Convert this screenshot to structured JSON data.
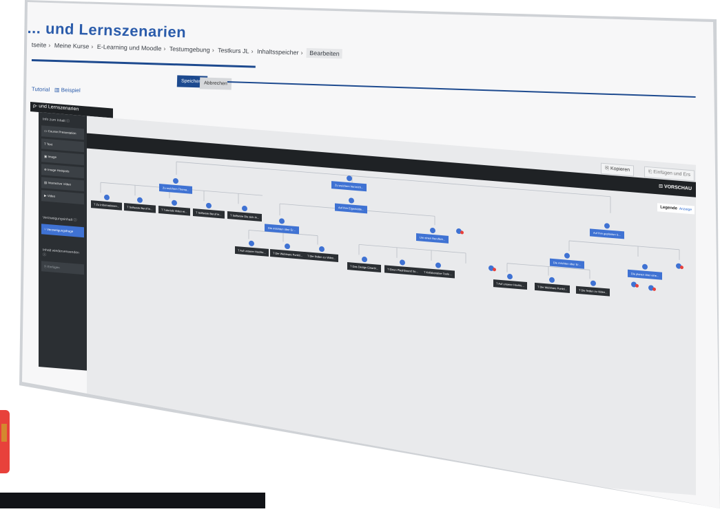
{
  "page": {
    "title": "... und Lernszenarien"
  },
  "breadcrumb": [
    "tseite",
    "Meine Kurse",
    "E-Learning und Moodle",
    "Testumgebung",
    "Testkurs JL",
    "Inhaltsspeicher",
    "Bearbeiten"
  ],
  "actions": {
    "save": "Speichern",
    "cancel": "Abbrechen"
  },
  "links": {
    "tutorial": "Tutorial",
    "example": "Beispiel"
  },
  "editor": {
    "header": "ρ- und Lernszenarien",
    "sidebar": {
      "section_content": "Info zum Inhalt ⓘ",
      "items": [
        "Course Presentation",
        "Text",
        "Image",
        "Image Hotspots",
        "Interactive Video",
        "Video"
      ],
      "section_branch": "Verzweigungsinhalt ⓘ",
      "branch_item": "Verzweigungsfrage",
      "section_reuse": "Inhalt wiederverwenden ⓘ",
      "reuse_item": "Einfügen"
    },
    "toolbar": {
      "copy": "Kopieren",
      "paste": "Einfügen und Ers",
      "preview": "VORSCHAU"
    },
    "legend": {
      "label": "Legende",
      "action": "Anzeige"
    }
  },
  "tree_nodes": [
    {
      "label": "Zu welchem Verzeich...",
      "kind": "question"
    },
    {
      "label": "Zu welchem Thema...",
      "kind": "question"
    },
    {
      "label": "Auf Ihre Eigenkätte...",
      "kind": "question"
    },
    {
      "label": "Auf Ihre geplanten S...",
      "kind": "question"
    },
    {
      "label": "Die möchten über Er...",
      "kind": "question"
    },
    {
      "label": "Um einen Beruflich...",
      "kind": "question"
    },
    {
      "label": "Die möchten über Er...",
      "kind": "question"
    },
    {
      "label": "Die planen über eine...",
      "kind": "question"
    },
    {
      "label": "Zu Informationen...",
      "kind": "content"
    },
    {
      "label": "Software Beruf in...",
      "kind": "content"
    },
    {
      "label": "Tutorials Video et...",
      "kind": "content"
    },
    {
      "label": "Software Beruf in...",
      "kind": "content"
    },
    {
      "label": "Software Die sich in...",
      "kind": "content"
    },
    {
      "label": "Auf unserer Hochle...",
      "kind": "content"
    },
    {
      "label": "Die Webinare Funkti...",
      "kind": "content"
    },
    {
      "label": "Die finden zu Video...",
      "kind": "content"
    },
    {
      "label": "Das Design Einarbi...",
      "kind": "content"
    },
    {
      "label": "Einen Flashbound Sc...",
      "kind": "content"
    },
    {
      "label": "Kollaborative Tools ...",
      "kind": "content"
    },
    {
      "label": "Auf unserer Hochle...",
      "kind": "content"
    },
    {
      "label": "Die Webinare Funkti...",
      "kind": "content"
    },
    {
      "label": "Die finden zu Video...",
      "kind": "content"
    }
  ],
  "colors": {
    "accent": "#3f72d3",
    "brand": "#1d4a8f",
    "dark": "#1f2225",
    "endnode": "#e8413b"
  }
}
